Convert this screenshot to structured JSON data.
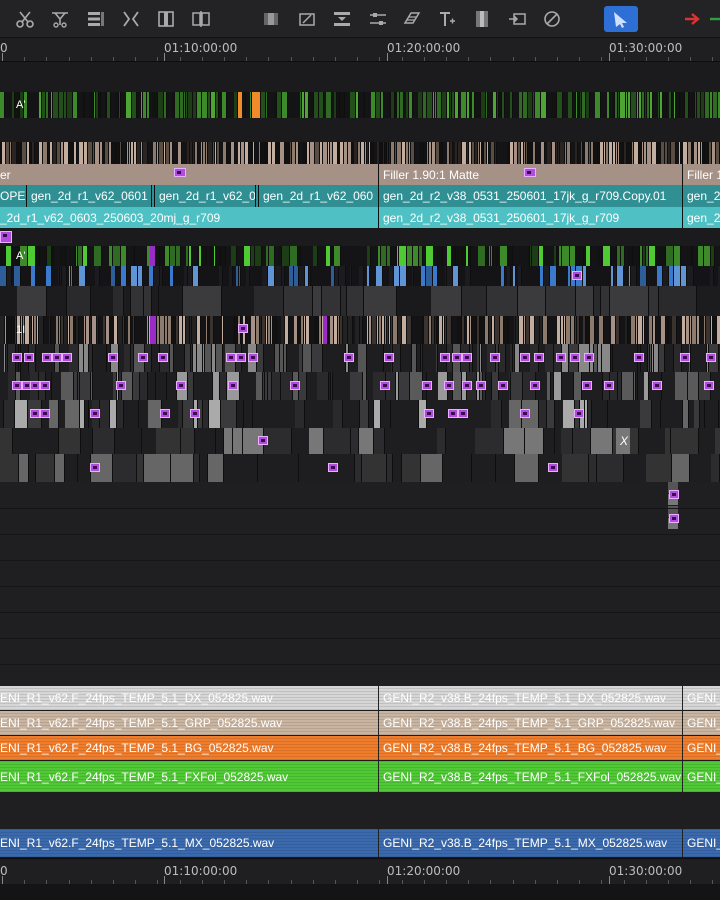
{
  "colors": {
    "background": "#1b1b1d",
    "toolbar": "#232326",
    "accent_blue": "#2e6fd6",
    "teal_clip": "#4fc1c4",
    "teal_clip_dark": "#2f8f93",
    "filler": "#a69186",
    "green_clip": "#3d8a2a",
    "lavender_marker": "#b04de0",
    "orange_audio": "#f07d2b",
    "green_audio": "#4fc934",
    "blue_audio": "#3a6aad",
    "white_audio": "#d6d6d6",
    "tan_audio": "#c9b4a0"
  },
  "toolbar": {
    "tools": [
      {
        "name": "scissors-icon",
        "label": ""
      },
      {
        "name": "trim-icon",
        "label": ""
      },
      {
        "name": "list-icon",
        "label": ""
      },
      {
        "name": "split-icon",
        "label": ""
      },
      {
        "name": "column-icon",
        "label": ""
      },
      {
        "name": "slip-icon",
        "label": ""
      },
      {
        "name": "monitor-icon",
        "label": ""
      },
      {
        "name": "crop-icon",
        "label": ""
      },
      {
        "name": "insert-icon",
        "label": ""
      },
      {
        "name": "sliders-icon",
        "label": ""
      },
      {
        "name": "eraser-icon",
        "label": ""
      },
      {
        "name": "title-icon",
        "label": ""
      },
      {
        "name": "film-icon",
        "label": ""
      },
      {
        "name": "export-icon",
        "label": ""
      },
      {
        "name": "disable-icon",
        "label": ""
      },
      {
        "name": "select-arrow-icon",
        "label": ""
      },
      {
        "name": "red-arrow-icon",
        "label": ""
      }
    ]
  },
  "ruler_top": {
    "labels": [
      "0",
      "01:10:00:00",
      "01:20:00:00",
      "01:30:00:00"
    ]
  },
  "ruler_bottom": {
    "labels": [
      "0",
      "01:10:00:00",
      "01:20:00:00",
      "01:30:00:00"
    ]
  },
  "video_tracks": {
    "v_a1_label": "A'",
    "v_a2_label": "A'",
    "v_mid_label": "1I",
    "filler_row": {
      "left_label": "er",
      "center_label": "Filler 1.90:1 Matte",
      "right_label": "Filler 1."
    },
    "clip_row_1": {
      "clips": [
        "OPEN",
        "gen_2d_r1_v62_0601",
        "gen_2d_r1_v62_0",
        "gen_2d_r1_v62_060",
        "gen_2d_r2_v38_0531_250601_17jk_g_r709.Copy.01",
        "gen_2"
      ]
    },
    "clip_row_2": {
      "clips": [
        "_2d_r1_v62_0603_250603_20mj_g_r709",
        "gen_2d_r2_v38_0531_250601_17jk_g_r709",
        "gen_2"
      ]
    },
    "x_marker": "X"
  },
  "audio_tracks": [
    {
      "name": "dx",
      "left": "ENI_R1_v62.F_24fps_TEMP_5.1_DX_052825.wav",
      "right": "GENI_R2_v38.B_24fps_TEMP_5.1_DX_052825.wav",
      "tail": "GENI_",
      "color": "#d6d6d6",
      "text": "#ffffff"
    },
    {
      "name": "grp",
      "left": "ENI_R1_v62.F_24fps_TEMP_5.1_GRP_052825.wav",
      "right": "GENI_R2_v38.B_24fps_TEMP_5.1_GRP_052825.wav",
      "tail": "GENI_",
      "color": "#c9b4a0",
      "text": "#ffffff"
    },
    {
      "name": "bg",
      "left": "ENI_R1_v62.F_24fps_TEMP_5.1_BG_052825.wav",
      "right": "GENI_R2_v38.B_24fps_TEMP_5.1_BG_052825.wav",
      "tail": "GENI_",
      "color": "#f07d2b",
      "text": "#ffffff"
    },
    {
      "name": "fxfol",
      "left": "ENI_R1_v62.F_24fps_TEMP_5.1_FXFol_052825.wav",
      "right": "GENI_R2_v38.B_24fps_TEMP_5.1_FXFol_052825.wav",
      "tail": "GENI_",
      "color": "#4fc934",
      "text": "#ffffff"
    },
    {
      "name": "mx",
      "left": "ENI_R1_v62.F_24fps_TEMP_5.1_MX_052825.wav",
      "right": "GENI_R2_v38.B_24fps_TEMP_5.1_MX_052825.wav",
      "tail": "GENI_",
      "color": "#3a6aad",
      "text": "#ffffff"
    }
  ]
}
